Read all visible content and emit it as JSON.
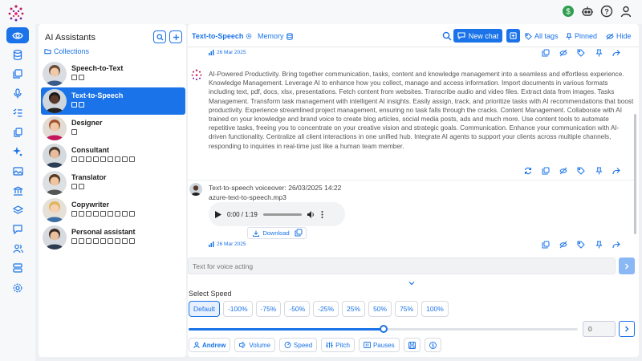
{
  "app": {
    "accent": "#1a73e8"
  },
  "topbar": {
    "icons": [
      "dollar-icon",
      "robot-icon",
      "help-icon",
      "user-icon"
    ]
  },
  "rail": {
    "icons": [
      "eye-icon",
      "database-icon",
      "gallery-icon",
      "microphone-icon",
      "checklist-icon",
      "copy-icon",
      "sparkles-icon",
      "image-icon",
      "bank-icon",
      "layers-icon",
      "chat-icon",
      "users-icon",
      "server-icon",
      "settings-icon"
    ],
    "active_index": 0
  },
  "panel": {
    "title": "AI Assistants",
    "collections_label": "Collections",
    "assistants": [
      {
        "name": "Speech-to-Text",
        "selected": false,
        "icon_count": 2
      },
      {
        "name": "Text-to-Speech",
        "selected": true,
        "icon_count": 2
      },
      {
        "name": "Designer",
        "selected": false,
        "icon_count": 1
      },
      {
        "name": "Consultant",
        "selected": false,
        "icon_count": 9
      },
      {
        "name": "Translator",
        "selected": false,
        "icon_count": 2
      },
      {
        "name": "Copywriter",
        "selected": false,
        "icon_count": 9
      },
      {
        "name": "Personal assistant",
        "selected": false,
        "icon_count": 9
      }
    ]
  },
  "chat": {
    "tab_active": "Text-to-Speech",
    "tab_memory": "Memory",
    "new_chat_label": "New chat",
    "all_tags_label": "All tags",
    "pinned_label": "Pinned",
    "hide_label": "Hide",
    "msg1_date": "26 Mar 2025",
    "ai_message": "AI-Powered Productivity. Bring together communication, tasks, content and knowledge management into a seamless and effortless experience. Knowledge Management. Leverage AI to enhance how you collect, manage and access information. Import documents in various formats including text, pdf, docs, xlsx, presentations. Fetch content from websites. Transcribe audio and video files. Extract data from images. Tasks Management. Transform task management with intelligent AI insights. Easily assign, track, and prioritize tasks with AI recommendations that boost productivity. Experience streamlined project management, ensuring no task falls through the cracks. Content Management. Collaborate with AI trained on your knowledge and brand voice to create blog articles, social media posts, ads and much more. Use content tools to automate repetitive tasks, freeing you to concentrate on your creative vision and strategic goals. Communication. Enhance your communication with AI-driven functionality. Centralize all client interactions in one unified hub. Integrate AI agents to support your clients across multiple channels, responding to inquiries in real-time just like a human team member.",
    "tts_header": "Text-to-speech voiceover: 26/03/2025 14:22",
    "tts_file": "azure-text-to-speech.mp3",
    "audio_time": "0:00 / 1:19",
    "audio_progress": 0,
    "download_label": "Download",
    "msg2_date": "26 Mar 2025",
    "input_placeholder": "Text for voice acting",
    "speed_label": "Select Speed",
    "speeds": [
      "Default",
      "-100%",
      "-75%",
      "-50%",
      "-25%",
      "25%",
      "50%",
      "75%",
      "100%"
    ],
    "speed_selected": 0,
    "slider_fraction": 0.5,
    "slider_value": "0",
    "options": {
      "voice": "Andrew",
      "volume": "Volume",
      "speed": "Speed",
      "pitch": "Pitch",
      "pauses": "Pauses"
    }
  }
}
